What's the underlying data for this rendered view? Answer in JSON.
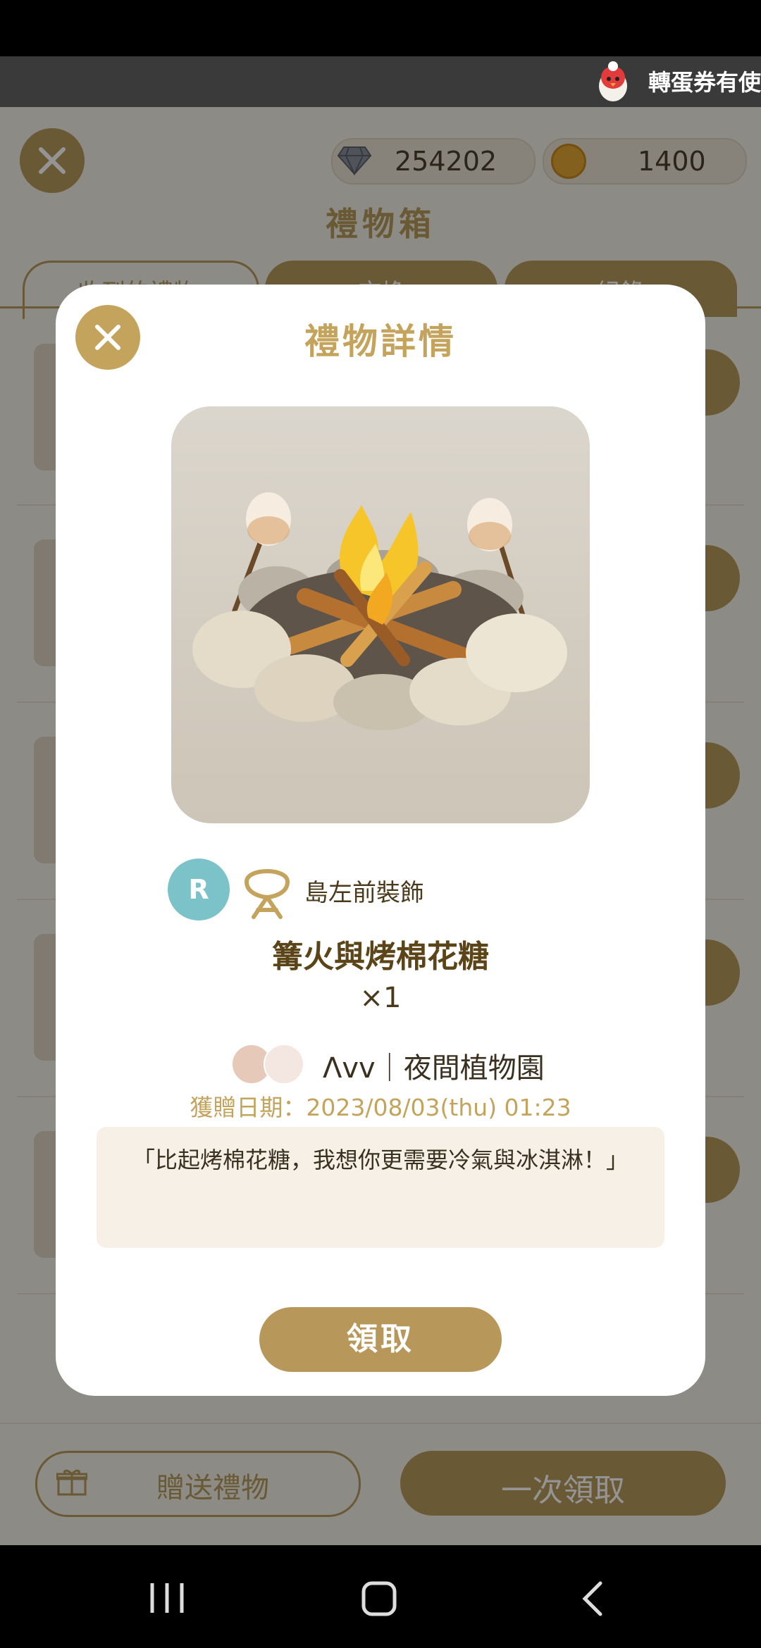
{
  "banner": {
    "text": "轉蛋券有使"
  },
  "currency": {
    "diamonds": "254202",
    "coins": "1400"
  },
  "background": {
    "title": "禮物箱",
    "tabs": [
      {
        "label": "收到的禮物"
      },
      {
        "label": "交換"
      },
      {
        "label": "紀錄"
      }
    ],
    "footer": {
      "send_label": "贈送禮物",
      "claim_all_label": "一次領取"
    }
  },
  "modal": {
    "title": "禮物詳情",
    "rarity": "R",
    "category": "島左前裝飾",
    "item_name": "篝火與烤棉花糖",
    "quantity": "×1",
    "sender": "Λvv｜夜間植物園",
    "received_date": "獲贈日期：2023/08/03(thu) 01:23",
    "message": "「比起烤棉花糖，我想你更需要冷氣與冰淇淋！」",
    "claim_label": "領取"
  },
  "colors": {
    "accent": "#c4a45c",
    "rarity_r": "#7cc3c9",
    "message_bg": "#f7f0e6"
  }
}
